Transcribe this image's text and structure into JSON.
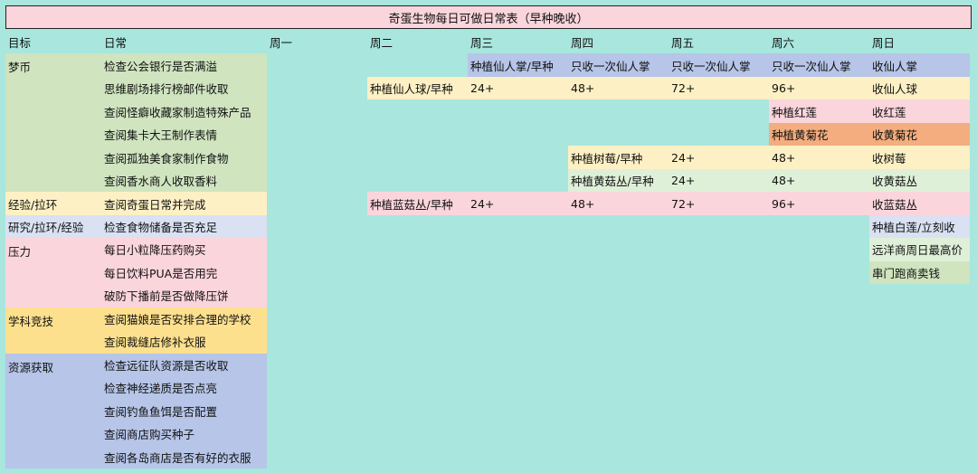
{
  "title": "奇蛋生物每日可做日常表（早种晚收）",
  "headers": [
    "目标",
    "日常",
    "周一",
    "周二",
    "周三",
    "周四",
    "周五",
    "周六",
    "周日"
  ],
  "categories": [
    "梦币",
    "经验/拉环",
    "研究/拉环/经验",
    "压力",
    "学科竞技",
    "资源获取"
  ],
  "tasks": [
    "检查公会银行是否满溢",
    "思维剧场排行榜邮件收取",
    "查阅怪癖收藏家制造特殊产品",
    "查阅集卡大王制作表情",
    "查阅孤独美食家制作食物",
    "查阅香水商人收取香料",
    "查阅奇蛋日常并完成",
    "检查食物储备是否充足",
    "每日小粒降压药购买",
    "每日饮料PUA是否用完",
    "破防下播前是否做降压饼",
    "查阅猫娘是否安排合理的学校",
    "查阅裁缝店修补衣服",
    "检查远征队资源是否收取",
    "检查神经递质是否点亮",
    "查阅钓鱼鱼饵是否配置",
    "查阅商店购买种子",
    "查阅各岛商店是否有好的衣服"
  ],
  "schedule": {
    "cactus": [
      "种植仙人掌/早种",
      "只收一次仙人掌",
      "只收一次仙人掌",
      "只收一次仙人掌",
      "收仙人掌"
    ],
    "ball": [
      "种植仙人球/早种",
      "24+",
      "48+",
      "72+",
      "96+",
      "收仙人球"
    ],
    "lotus": [
      "种植红莲",
      "收红莲"
    ],
    "chrys": [
      "种植黄菊花",
      "收黄菊花"
    ],
    "berry": [
      "种植树莓/早种",
      "24+",
      "48+",
      "收树莓"
    ],
    "ymush": [
      "种植黄菇丛/早种",
      "24+",
      "48+",
      "收黄菇丛"
    ],
    "bmush": [
      "种植蓝菇丛/早种",
      "24+",
      "48+",
      "72+",
      "96+",
      "收蓝菇丛"
    ],
    "white": [
      "种植白莲/立刻收"
    ],
    "sunday": [
      "远洋商周日最高价",
      "串门跑商卖钱"
    ]
  },
  "colors": {
    "background": "#a8e6de",
    "pink": "#fbd5dc",
    "yellow": "#fdf0c4",
    "green": "#cfe4bf",
    "light_green": "#dff0d8",
    "blue": "#b6c5e8",
    "light_blue": "#d9e1f2",
    "orange": "#f3ad7e",
    "gold": "#fde08e"
  }
}
